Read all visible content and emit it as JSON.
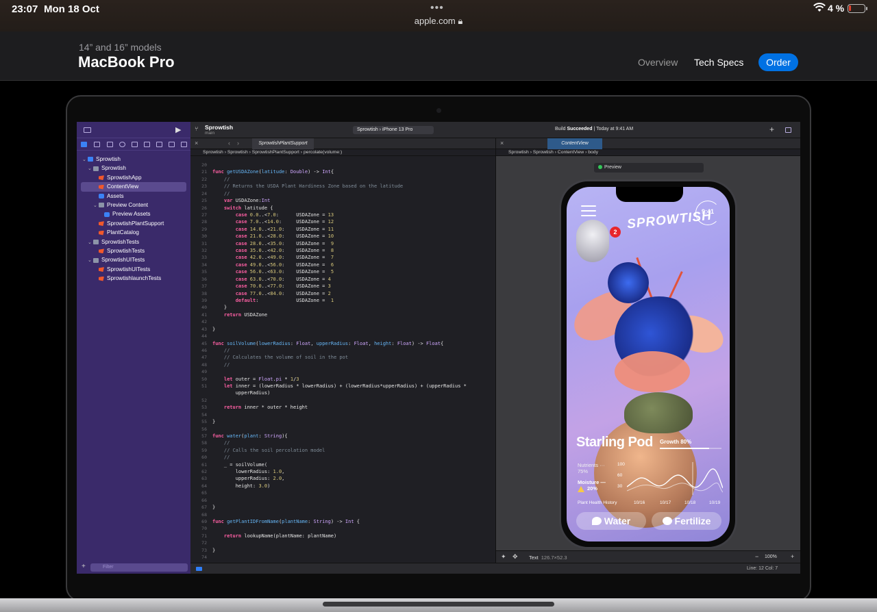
{
  "status_bar": {
    "time": "23:07",
    "date": "Mon 18 Oct",
    "url": "apple.com",
    "battery": "4 %"
  },
  "apple_nav": {
    "eyebrow": "14” and 16” models",
    "title": "MacBook Pro",
    "links": [
      "Overview",
      "Tech Specs"
    ],
    "cta": "Order"
  },
  "xcode": {
    "project": "Sprowtish",
    "branch": "main",
    "scheme": "Sprowtish",
    "device": "iPhone 13 Pro",
    "build_status_prefix": "Build ",
    "build_status": "Succeeded",
    "build_time": "| Today at 9:41 AM",
    "navigator": [
      {
        "label": "Sprowtish",
        "icon": "proj",
        "indent": 0,
        "chev": true
      },
      {
        "label": "Sprowtish",
        "icon": "folder",
        "indent": 1,
        "chev": true
      },
      {
        "label": "SprowtishApp",
        "icon": "swift",
        "indent": 2,
        "chev": false
      },
      {
        "label": "ContentView",
        "icon": "swift",
        "indent": 2,
        "chev": false
      },
      {
        "label": "Assets",
        "icon": "assets",
        "indent": 2,
        "chev": false
      },
      {
        "label": "Preview Content",
        "icon": "folder",
        "indent": 2,
        "chev": true
      },
      {
        "label": "Preview Assets",
        "icon": "assets",
        "indent": 3,
        "chev": false
      },
      {
        "label": "SprowtishPlantSupport",
        "icon": "swift",
        "indent": 2,
        "chev": false
      },
      {
        "label": "PlantCatalog",
        "icon": "swift",
        "indent": 2,
        "chev": false
      },
      {
        "label": "SprowtishTests",
        "icon": "folder",
        "indent": 1,
        "chev": true
      },
      {
        "label": "SprowtishTests",
        "icon": "swift",
        "indent": 2,
        "chev": false
      },
      {
        "label": "SprowtishUITests",
        "icon": "folder",
        "indent": 1,
        "chev": true
      },
      {
        "label": "SprowtishUITests",
        "icon": "swift",
        "indent": 2,
        "chev": false
      },
      {
        "label": "SprowtishlaunchTests",
        "icon": "swift",
        "indent": 2,
        "chev": false
      }
    ],
    "filter_placeholder": "Filter",
    "editor_tab": "SprowtishPlantSupport",
    "editor_jump": [
      "Sprowtish",
      "Sprowtish",
      "SprowtishPlantSupport",
      "percolate(volume:)"
    ],
    "canvas_tab": "ContentView",
    "canvas_jump": [
      "Sprowtish",
      "Sprowtish",
      "ContentView",
      "body"
    ],
    "preview_label": "Preview",
    "code_lines": [
      {
        "n": "20",
        "h": ""
      },
      {
        "n": "21",
        "h": "<span class='kw'>func</span> <span class='fn'>getUSDAZone</span>(<span class='fn'>latitude</span>: <span class='ty'>Double</span>) -> <span class='ty'>Int</span>{"
      },
      {
        "n": "22",
        "h": "    <span class='cm'>//</span>"
      },
      {
        "n": "23",
        "h": "    <span class='cm'>// Returns the USDA Plant Hardiness Zone based on the latitude</span>"
      },
      {
        "n": "24",
        "h": "    <span class='cm'>//</span>"
      },
      {
        "n": "25",
        "h": "    <span class='kw'>var</span> USDAZone:<span class='ty'>Int</span>"
      },
      {
        "n": "26",
        "h": "    <span class='kw'>switch</span> latitude {"
      },
      {
        "n": "27",
        "h": "        <span class='kw'>case</span> <span class='num'>0.0</span>..<<span class='num'>7.0</span>:      USDAZone = <span class='num'>13</span>"
      },
      {
        "n": "28",
        "h": "        <span class='kw'>case</span> <span class='num'>7.0</span>..<<span class='num'>14.0</span>:     USDAZone = <span class='num'>12</span>"
      },
      {
        "n": "29",
        "h": "        <span class='kw'>case</span> <span class='num'>14.0</span>..<<span class='num'>21.0</span>:    USDAZone = <span class='num'>11</span>"
      },
      {
        "n": "30",
        "h": "        <span class='kw'>case</span> <span class='num'>21.0</span>..<<span class='num'>28.0</span>:    USDAZone = <span class='num'>10</span>"
      },
      {
        "n": "31",
        "h": "        <span class='kw'>case</span> <span class='num'>28.0</span>..<<span class='num'>35.0</span>:    USDAZone =  <span class='num'>9</span>"
      },
      {
        "n": "32",
        "h": "        <span class='kw'>case</span> <span class='num'>35.0</span>..<<span class='num'>42.0</span>:    USDAZone =  <span class='num'>8</span>"
      },
      {
        "n": "33",
        "h": "        <span class='kw'>case</span> <span class='num'>42.0</span>..<<span class='num'>49.0</span>:    USDAZone =  <span class='num'>7</span>"
      },
      {
        "n": "34",
        "h": "        <span class='kw'>case</span> <span class='num'>49.0</span>..<<span class='num'>56.0</span>:    USDAZone =  <span class='num'>6</span>"
      },
      {
        "n": "35",
        "h": "        <span class='kw'>case</span> <span class='num'>56.0</span>..<<span class='num'>63.0</span>:    USDAZone =  <span class='num'>5</span>"
      },
      {
        "n": "36",
        "h": "        <span class='kw'>case</span> <span class='num'>63.0</span>..<<span class='num'>70.0</span>:    USDAZone = <span class='num'>4</span>"
      },
      {
        "n": "37",
        "h": "        <span class='kw'>case</span> <span class='num'>70.0</span>..<<span class='num'>77.0</span>:    USDAZone = <span class='num'>3</span>"
      },
      {
        "n": "38",
        "h": "        <span class='kw'>case</span> <span class='num'>77.0</span>..<<span class='num'>84.0</span>:    USDAZone = <span class='num'>2</span>"
      },
      {
        "n": "39",
        "h": "        <span class='kw'>default</span>:             USDAZone =  <span class='num'>1</span>"
      },
      {
        "n": "40",
        "h": "    }"
      },
      {
        "n": "41",
        "h": "    <span class='kw'>return</span> USDAZone"
      },
      {
        "n": "42",
        "h": ""
      },
      {
        "n": "43",
        "h": "}"
      },
      {
        "n": "44",
        "h": ""
      },
      {
        "n": "45",
        "h": "<span class='kw'>func</span> <span class='fn'>soilVolume</span>(<span class='fn'>lowerRadius</span>: <span class='ty'>Float</span>, <span class='fn'>upperRadius</span>: <span class='ty'>Float</span>, <span class='fn'>height</span>: <span class='ty'>Float</span>) -> <span class='ty'>Float</span>{"
      },
      {
        "n": "46",
        "h": "    <span class='cm'>//</span>"
      },
      {
        "n": "47",
        "h": "    <span class='cm'>// Calculates the volume of soil in the pot</span>"
      },
      {
        "n": "48",
        "h": "    <span class='cm'>//</span>"
      },
      {
        "n": "49",
        "h": ""
      },
      {
        "n": "50",
        "h": "    <span class='kw'>let</span> outer = <span class='ty'>Float</span>.<span class='ty'>pi</span> * <span class='num'>1</span>/<span class='num'>3</span>"
      },
      {
        "n": "51",
        "h": "    <span class='kw'>let</span> inner = (lowerRadius * lowerRadius) + (lowerRadius*upperRadius) + (upperRadius *"
      },
      {
        "n": "",
        "h": "        upperRadius)"
      },
      {
        "n": "52",
        "h": ""
      },
      {
        "n": "53",
        "h": "    <span class='kw'>return</span> inner * outer * height"
      },
      {
        "n": "54",
        "h": ""
      },
      {
        "n": "55",
        "h": "}"
      },
      {
        "n": "56",
        "h": ""
      },
      {
        "n": "57",
        "h": "<span class='kw'>func</span> <span class='fn'>water</span>(<span class='fn'>plant</span>: <span class='ty'>String</span>){"
      },
      {
        "n": "58",
        "h": "    <span class='cm'>//</span>"
      },
      {
        "n": "59",
        "h": "    <span class='cm'>// Calls the soil percolation model</span>"
      },
      {
        "n": "60",
        "h": "    <span class='cm'>//</span>"
      },
      {
        "n": "61",
        "h": "    _ = soilVolume("
      },
      {
        "n": "62",
        "h": "        lowerRadius: <span class='num'>1.0</span>,"
      },
      {
        "n": "63",
        "h": "        upperRadius: <span class='num'>2.0</span>,"
      },
      {
        "n": "64",
        "h": "        height: <span class='num'>3.0</span>)"
      },
      {
        "n": "65",
        "h": ""
      },
      {
        "n": "66",
        "h": ""
      },
      {
        "n": "67",
        "h": "}"
      },
      {
        "n": "68",
        "h": ""
      },
      {
        "n": "69",
        "h": "<span class='kw'>func</span> <span class='fn'>getPlantIDFromName</span>(<span class='fn'>plantName</span>: <span class='ty'>String</span>) -> <span class='ty'>Int</span> {"
      },
      {
        "n": "70",
        "h": ""
      },
      {
        "n": "71",
        "h": "    <span class='kw'>return</span> lookupName(plantName: plantName)"
      },
      {
        "n": "72",
        "h": ""
      },
      {
        "n": "73",
        "h": "}"
      },
      {
        "n": "74",
        "h": ""
      }
    ],
    "inspector_element": "Text",
    "inspector_size": "126.7×52.3",
    "zoom": "100%",
    "cursor": "Line: 12  Col: 7"
  },
  "phone_app": {
    "time": "9:41",
    "logo": "SPROWTISH",
    "notification_count": "2",
    "plant_name": "Starling Pod",
    "growth_label": "Growth 80%",
    "growth_value": 0.8,
    "nutrients_label": "Nutrients",
    "nutrients_value": "75%",
    "moisture_label": "Moisture",
    "moisture_value": "20%",
    "y_ticks": [
      "100",
      "60",
      "30"
    ],
    "chart_caption": "Plant Health History",
    "x_ticks": [
      "10/16",
      "10/17",
      "10/18",
      "10/19"
    ],
    "water_button": "Water",
    "fertilize_button": "Fertilize"
  }
}
